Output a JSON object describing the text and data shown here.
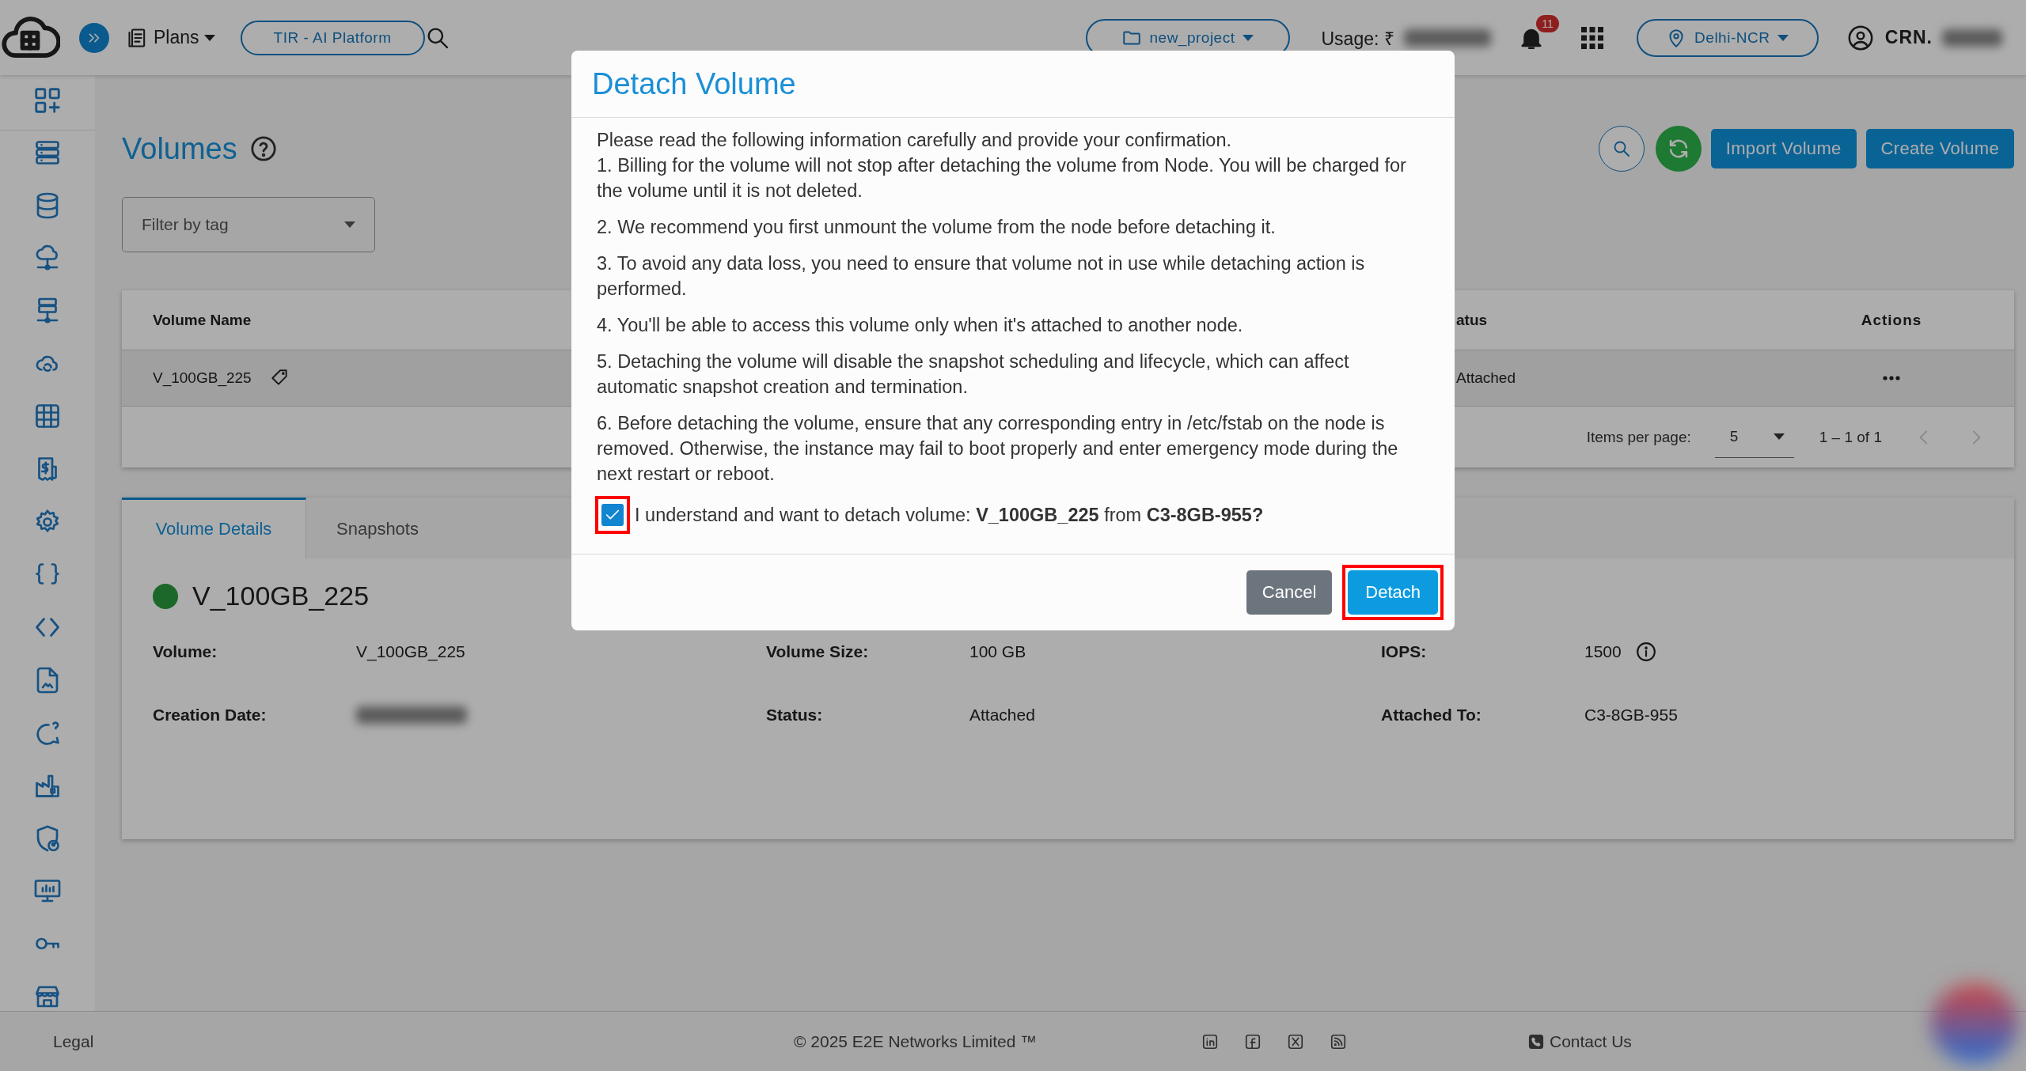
{
  "topbar": {
    "plans": "Plans",
    "platform": "TIR - AI Platform",
    "project": "new_project",
    "usage_label": "Usage: ₹",
    "notifications": "11",
    "region": "Delhi-NCR",
    "account_label": "CRN."
  },
  "page": {
    "title": "Volumes",
    "filter": {
      "placeholder": "Filter by tag"
    },
    "actions": [
      "Import Volume",
      "Create Volume"
    ]
  },
  "table": {
    "columns": [
      "Volume Name",
      "atus",
      "Actions"
    ],
    "rows": [
      {
        "selected": true,
        "name": "V_100GB_225",
        "status": "Attached"
      }
    ],
    "paginator": {
      "label": "Items per page:",
      "page_size": "5",
      "range": "1 – 1 of 1"
    }
  },
  "details": {
    "tabs": [
      {
        "label": "Volume Details",
        "selected": true
      },
      {
        "label": "Snapshots",
        "selected": false
      }
    ],
    "name": "V_100GB_225",
    "fields": [
      {
        "label": "Volume:",
        "value": "V_100GB_225"
      },
      {
        "label": "Volume Size:",
        "value": "100 GB"
      },
      {
        "label": "IOPS:",
        "value": "1500",
        "info": true
      },
      {
        "label": "Creation Date:",
        "redacted": true
      },
      {
        "label": "Status:",
        "value": "Attached"
      },
      {
        "label": "Attached To:",
        "value": "C3-8GB-955"
      }
    ]
  },
  "dialog": {
    "title": "Detach Volume",
    "intro": "Please read the following information carefully and provide your confirmation.",
    "points": [
      "1. Billing for the volume will not stop after detaching the volume from Node. You will be charged for the volume until it is not deleted.",
      "2. We recommend you first unmount the volume from the node before detaching it.",
      "3. To avoid any data loss, you need to ensure that volume not in use while detaching action is performed.",
      "4. You'll be able to access this volume only when it's attached to another node.",
      "5. Detaching the volume will disable the snapshot scheduling and lifecycle, which can affect automatic snapshot creation and termination.",
      "6. Before detaching the volume, ensure that any corresponding entry in /etc/fstab on the node is removed. Otherwise, the instance may fail to boot properly and enter emergency mode during the next restart or reboot."
    ],
    "confirm": {
      "checked": true,
      "highlighted": true,
      "text": "I understand and want to detach volume: **V_100GB_225** from **C3-8GB-955?**"
    },
    "buttons": [
      {
        "label": "Cancel",
        "kind": "secondary",
        "highlighted": false
      },
      {
        "label": "Detach",
        "kind": "primary",
        "highlighted": true
      }
    ]
  },
  "footer": {
    "legal": "Legal",
    "copyright": "© 2025 E2E Networks Limited ™",
    "contact": "Contact Us"
  }
}
